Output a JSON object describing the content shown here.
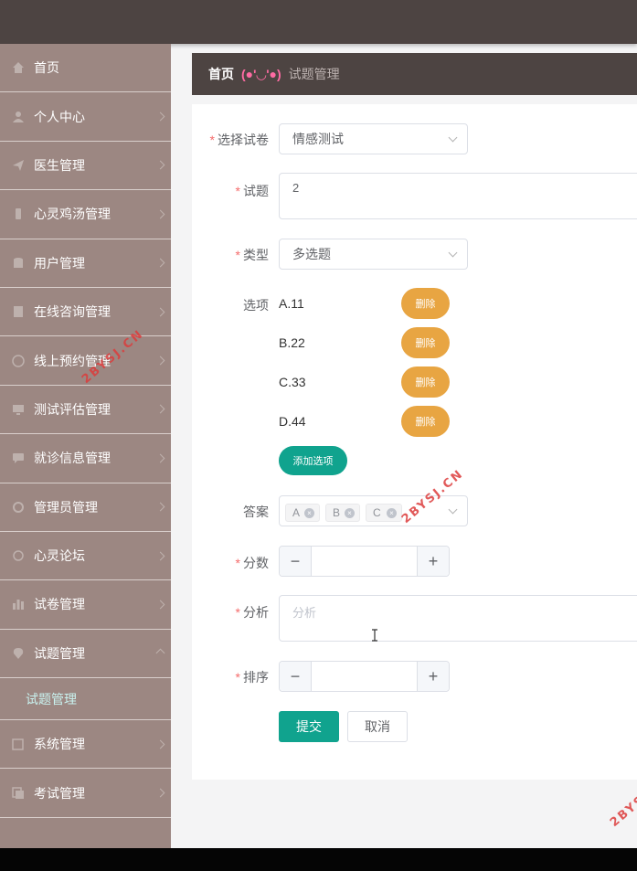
{
  "sidebar": {
    "items": [
      {
        "label": "首页",
        "icon": "home-icon"
      },
      {
        "label": "个人中心",
        "icon": "user-icon"
      },
      {
        "label": "医生管理",
        "icon": "send-icon"
      },
      {
        "label": "心灵鸡汤管理",
        "icon": "phone-icon"
      },
      {
        "label": "用户管理",
        "icon": "database-icon"
      },
      {
        "label": "在线咨询管理",
        "icon": "document-icon"
      },
      {
        "label": "线上预约管理",
        "icon": "clock-icon"
      },
      {
        "label": "测试评估管理",
        "icon": "monitor-icon"
      },
      {
        "label": "就诊信息管理",
        "icon": "chat-icon"
      },
      {
        "label": "管理员管理",
        "icon": "refresh-icon"
      },
      {
        "label": "心灵论坛",
        "icon": "circle-icon"
      },
      {
        "label": "试卷管理",
        "icon": "bar-chart-icon"
      },
      {
        "label": "试题管理",
        "icon": "location-icon"
      },
      {
        "label": "系统管理",
        "icon": "edit-icon"
      },
      {
        "label": "考试管理",
        "icon": "copy-icon"
      }
    ],
    "sub_item": "试题管理"
  },
  "breadcrumb": {
    "home": "首页",
    "face": "(●'◡'●)",
    "current": "试题管理"
  },
  "form": {
    "paper_label": "选择试卷",
    "paper_value": "情感测试",
    "question_label": "试题",
    "question_value": "2",
    "type_label": "类型",
    "type_value": "多选题",
    "options_label": "选项",
    "options": [
      "A.11",
      "B.22",
      "C.33",
      "D.44"
    ],
    "delete_label": "删除",
    "add_option_label": "添加选项",
    "answer_label": "答案",
    "answer_tags": [
      "A",
      "B",
      "C"
    ],
    "score_label": "分数",
    "analysis_label": "分析",
    "analysis_placeholder": "分析",
    "order_label": "排序",
    "submit_label": "提交",
    "cancel_label": "取消"
  },
  "watermark": "2BYSJ.CN",
  "colors": {
    "accent": "#10a38e",
    "delete": "#e8a542",
    "sidebar": "#9c8782",
    "topbar": "#4d4442",
    "required": "#f56c6c"
  }
}
